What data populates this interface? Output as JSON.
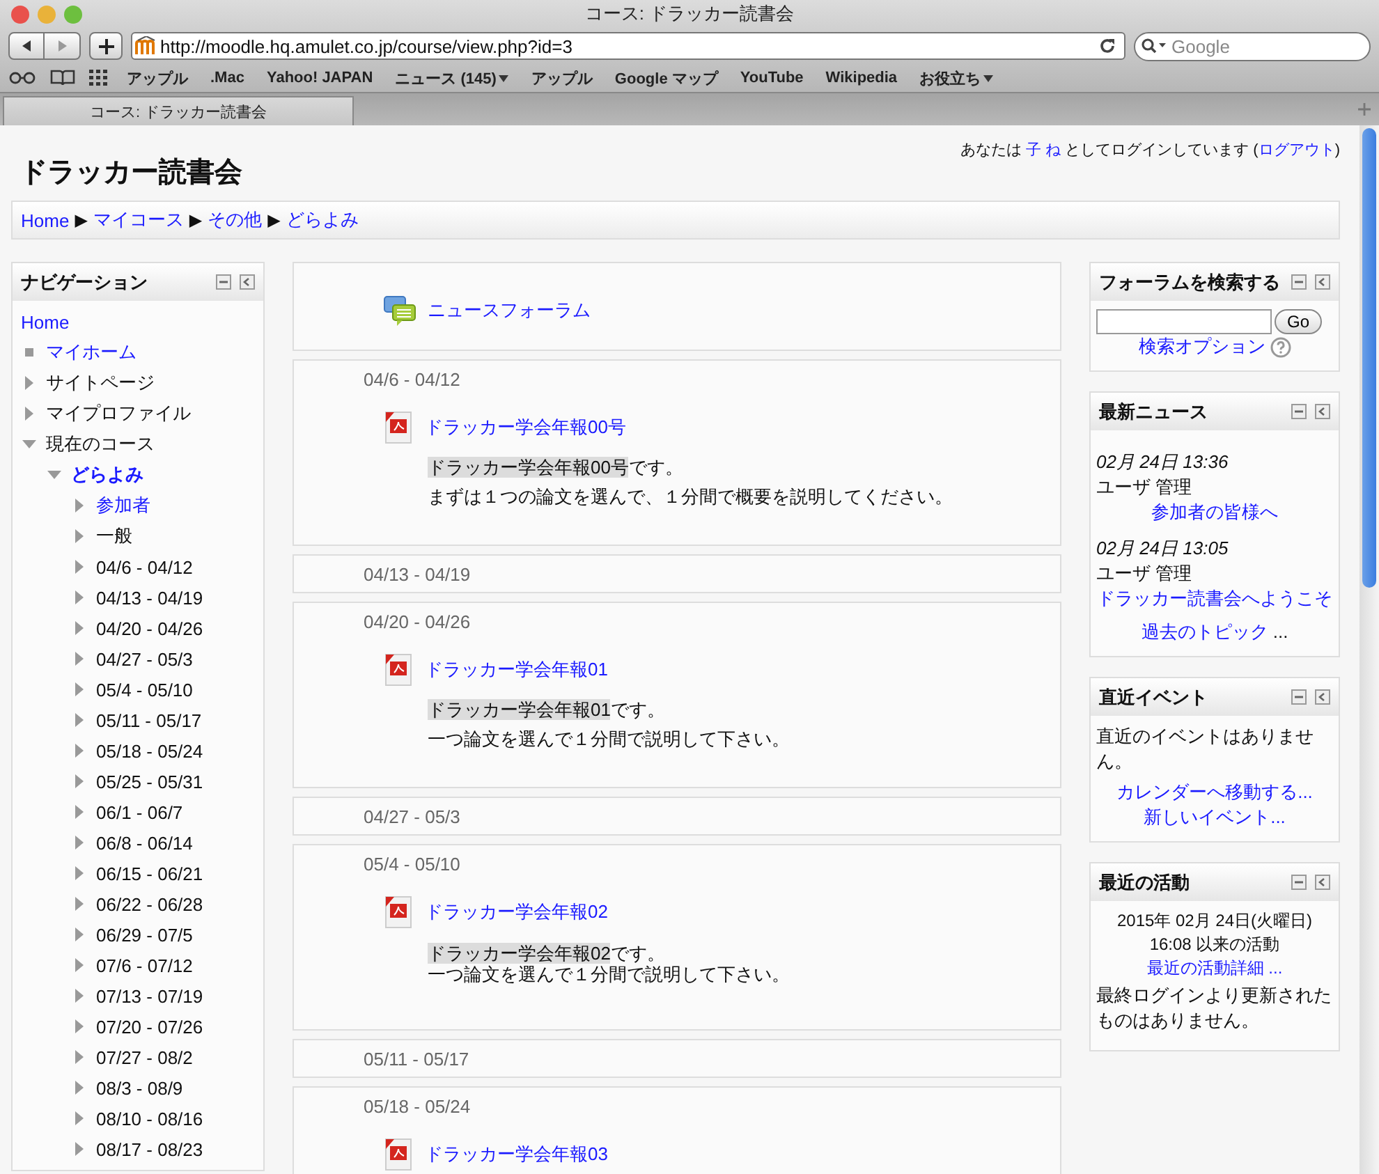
{
  "browser": {
    "title": "コース: ドラッカー読書会",
    "url": "http://moodle.hq.amulet.co.jp/course/view.php?id=3",
    "search_placeholder": "Google",
    "bookmarks": [
      {
        "label": "アップル",
        "menu": false
      },
      {
        "label": ".Mac",
        "menu": false
      },
      {
        "label": "Yahoo! JAPAN",
        "menu": false
      },
      {
        "label": "ニュース (145)",
        "menu": true
      },
      {
        "label": "アップル",
        "menu": false
      },
      {
        "label": "Google マップ",
        "menu": false
      },
      {
        "label": "YouTube",
        "menu": false
      },
      {
        "label": "Wikipedia",
        "menu": false
      },
      {
        "label": "お役立ち",
        "menu": true
      }
    ],
    "tabs": [
      {
        "label": "コース: ドラッカー読書会",
        "selected": true
      }
    ]
  },
  "site_title": "ドラッカー読書会",
  "login": {
    "prefix": "あなたは",
    "user": "子 ね",
    "middle": "としてログインしています (",
    "logout": "ログアウト",
    "suffix": ")"
  },
  "breadcrumb": [
    {
      "kind": "link",
      "text": "Home"
    },
    {
      "kind": "sep",
      "text": "▶"
    },
    {
      "kind": "link",
      "text": "マイコース"
    },
    {
      "kind": "sep",
      "text": "▶"
    },
    {
      "kind": "link",
      "text": "その他"
    },
    {
      "kind": "sep",
      "text": "▶"
    },
    {
      "kind": "link",
      "text": "どらよみ"
    }
  ],
  "navigation": {
    "title": "ナビゲーション",
    "items": [
      {
        "label": "Home",
        "kind": "plain",
        "link": true
      },
      {
        "label": "マイホーム",
        "kind": "leaf",
        "link": true
      },
      {
        "label": "サイトページ",
        "kind": "branch",
        "link": false,
        "expanded": false
      },
      {
        "label": "マイプロファイル",
        "kind": "branch",
        "link": false,
        "expanded": false
      },
      {
        "label": "現在のコース",
        "kind": "branch",
        "link": false,
        "expanded": true,
        "children": [
          {
            "label": "どらよみ",
            "kind": "branch",
            "link": true,
            "current": true,
            "expanded": true,
            "children": [
              {
                "label": "参加者",
                "kind": "branch",
                "link": true,
                "expanded": false
              },
              {
                "label": "一般",
                "kind": "branch",
                "link": false,
                "expanded": false
              },
              {
                "label": "04/6 - 04/12",
                "kind": "branch",
                "link": false,
                "expanded": false
              },
              {
                "label": "04/13 - 04/19",
                "kind": "branch",
                "link": false,
                "expanded": false
              },
              {
                "label": "04/20 - 04/26",
                "kind": "branch",
                "link": false,
                "expanded": false
              },
              {
                "label": "04/27 - 05/3",
                "kind": "branch",
                "link": false,
                "expanded": false
              },
              {
                "label": "05/4 - 05/10",
                "kind": "branch",
                "link": false,
                "expanded": false
              },
              {
                "label": "05/11 - 05/17",
                "kind": "branch",
                "link": false,
                "expanded": false
              },
              {
                "label": "05/18 - 05/24",
                "kind": "branch",
                "link": false,
                "expanded": false
              },
              {
                "label": "05/25 - 05/31",
                "kind": "branch",
                "link": false,
                "expanded": false
              },
              {
                "label": "06/1 - 06/7",
                "kind": "branch",
                "link": false,
                "expanded": false
              },
              {
                "label": "06/8 - 06/14",
                "kind": "branch",
                "link": false,
                "expanded": false
              },
              {
                "label": "06/15 - 06/21",
                "kind": "branch",
                "link": false,
                "expanded": false
              },
              {
                "label": "06/22 - 06/28",
                "kind": "branch",
                "link": false,
                "expanded": false
              },
              {
                "label": "06/29 - 07/5",
                "kind": "branch",
                "link": false,
                "expanded": false
              },
              {
                "label": "07/6 - 07/12",
                "kind": "branch",
                "link": false,
                "expanded": false
              },
              {
                "label": "07/13 - 07/19",
                "kind": "branch",
                "link": false,
                "expanded": false
              },
              {
                "label": "07/20 - 07/26",
                "kind": "branch",
                "link": false,
                "expanded": false
              },
              {
                "label": "07/27 - 08/2",
                "kind": "branch",
                "link": false,
                "expanded": false
              },
              {
                "label": "08/3 - 08/9",
                "kind": "branch",
                "link": false,
                "expanded": false
              },
              {
                "label": "08/10 - 08/16",
                "kind": "branch",
                "link": false,
                "expanded": false
              },
              {
                "label": "08/17 - 08/23",
                "kind": "branch",
                "link": false,
                "expanded": false
              }
            ]
          }
        ]
      }
    ]
  },
  "sections": [
    {
      "activities": [
        {
          "kind": "forum",
          "name": "ニュースフォーラム"
        }
      ]
    },
    {
      "heading": "04/6 - 04/12",
      "activities": [
        {
          "kind": "pdf",
          "name": "ドラッカー学会年報00号",
          "highlight": "ドラッカー学会年報00号",
          "rest": "です。",
          "note": "まずは１つの論文を選んで、１分間で概要を説明してください。",
          "tight": false
        }
      ]
    },
    {
      "heading": "04/13 - 04/19"
    },
    {
      "heading": "04/20 - 04/26",
      "activities": [
        {
          "kind": "pdf",
          "name": "ドラッカー学会年報01",
          "highlight": "ドラッカー学会年報01",
          "rest": "です。",
          "note": "一つ論文を選んで１分間で説明して下さい。",
          "tight": false
        }
      ]
    },
    {
      "heading": "04/27 - 05/3"
    },
    {
      "heading": "05/4 - 05/10",
      "activities": [
        {
          "kind": "pdf",
          "name": "ドラッカー学会年報02",
          "highlight": "ドラッカー学会年報02",
          "rest": "です。",
          "note": "一つ論文を選んで１分間で説明して下さい。",
          "tight": true
        }
      ]
    },
    {
      "heading": "05/11 - 05/17"
    },
    {
      "heading": "05/18 - 05/24",
      "activities": [
        {
          "kind": "pdf",
          "name": "ドラッカー学会年報03"
        }
      ]
    }
  ],
  "blocks": [
    {
      "kind": "search",
      "title": "フォーラムを検索する",
      "button": "Go",
      "link": "検索オプション"
    },
    {
      "kind": "news",
      "title": "最新ニュース",
      "items": [
        {
          "date": "02月 24日 13:36",
          "author": "ユーザ 管理",
          "title": "参加者の皆様へ"
        },
        {
          "date": "02月 24日 13:05",
          "author": "ユーザ 管理",
          "title": "ドラッカー読書会へようこそ"
        }
      ],
      "more_link": "過去のトピック",
      "more_suffix": "..."
    },
    {
      "kind": "events",
      "title": "直近イベント",
      "text": "直近のイベントはありません。",
      "links": [
        "カレンダーへ移動する...",
        "新しいイベント..."
      ]
    },
    {
      "kind": "activity",
      "title": "最近の活動",
      "lines": [
        "2015年 02月 24日(火曜日)",
        "16:08 以来の活動"
      ],
      "link": "最近の活動詳細 ...",
      "text": "最終ログインより更新されたものはありません。"
    }
  ]
}
